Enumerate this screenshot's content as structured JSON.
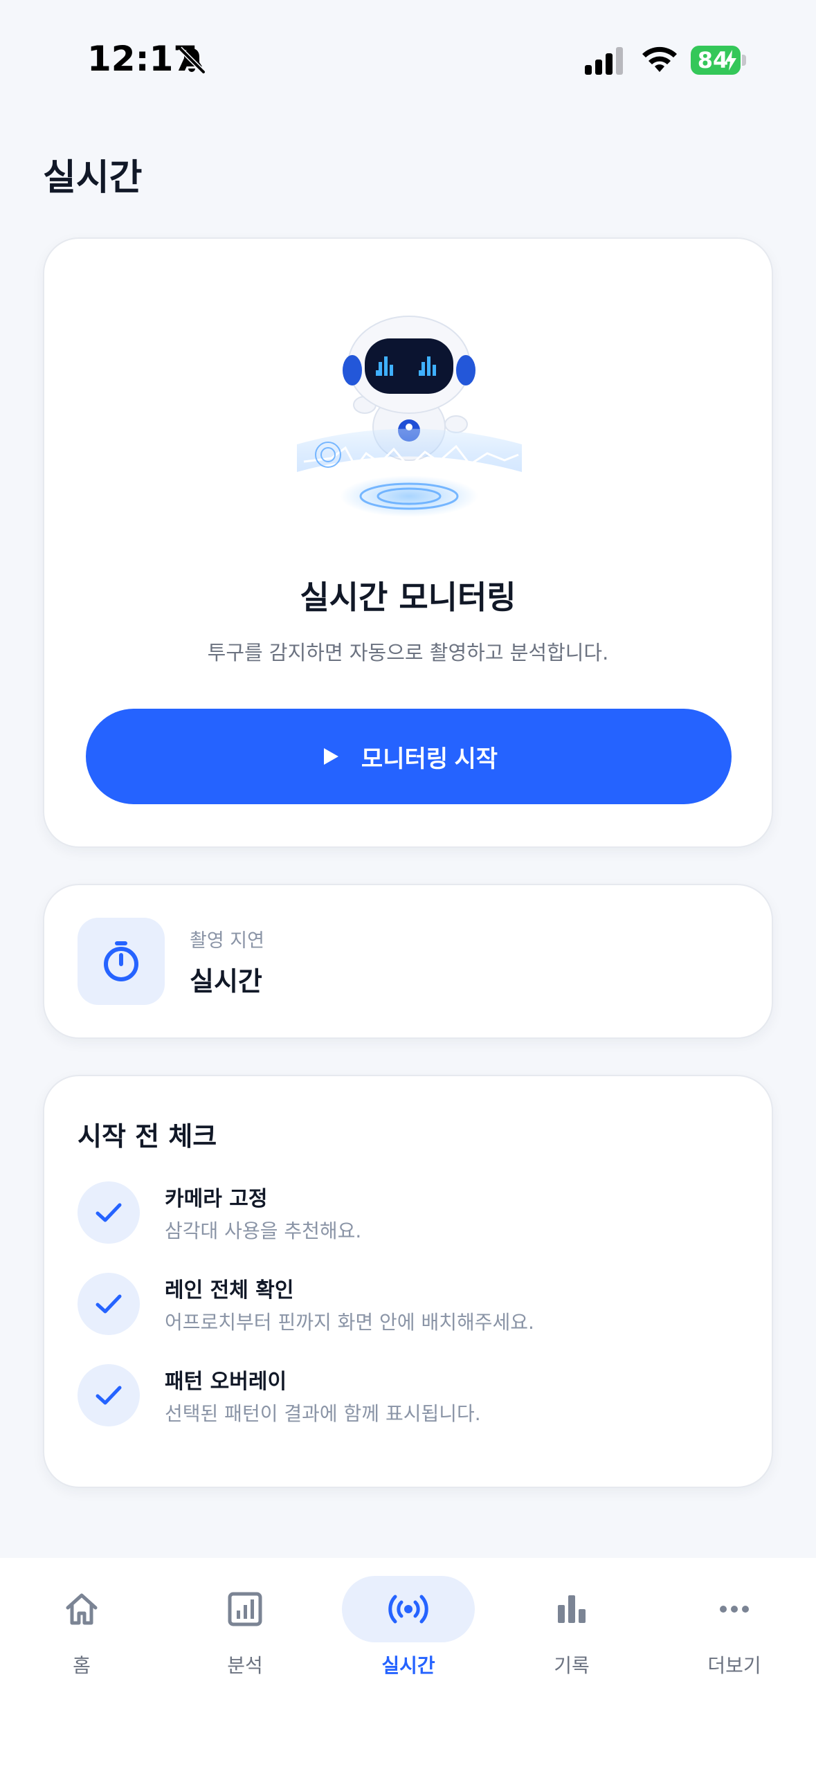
{
  "status_bar": {
    "time": "12:17",
    "battery_percent": "84",
    "icons": [
      "bell-slash-icon",
      "cellular-signal-icon",
      "wifi-icon",
      "battery-charging-icon"
    ]
  },
  "page": {
    "title": "실시간"
  },
  "hero": {
    "illustration": "robot-monitoring-illustration",
    "title": "실시간 모니터링",
    "subtitle": "투구를 감지하면 자동으로 촬영하고 분석합니다.",
    "start_button_label": "모니터링 시작",
    "button_icon": "play-icon",
    "accent_color": "#2563ff"
  },
  "delay": {
    "icon": "stopwatch-icon",
    "label": "촬영 지연",
    "value": "실시간"
  },
  "checklist": {
    "title": "시작 전 체크",
    "items": [
      {
        "title": "카메라 고정",
        "description": "삼각대 사용을 추천해요.",
        "checked": true
      },
      {
        "title": "레인 전체 확인",
        "description": "어프로치부터 핀까지 화면 안에 배치해주세요.",
        "checked": true
      },
      {
        "title": "패턴 오버레이",
        "description": "선택된 패턴이 결과에 함께 표시됩니다.",
        "checked": true
      }
    ]
  },
  "tab_bar": {
    "active_index": 2,
    "tabs": [
      {
        "label": "홈",
        "icon": "home-icon"
      },
      {
        "label": "분석",
        "icon": "analysis-chart-icon"
      },
      {
        "label": "실시간",
        "icon": "live-broadcast-icon"
      },
      {
        "label": "기록",
        "icon": "bar-chart-icon"
      },
      {
        "label": "더보기",
        "icon": "more-dots-icon"
      }
    ]
  }
}
